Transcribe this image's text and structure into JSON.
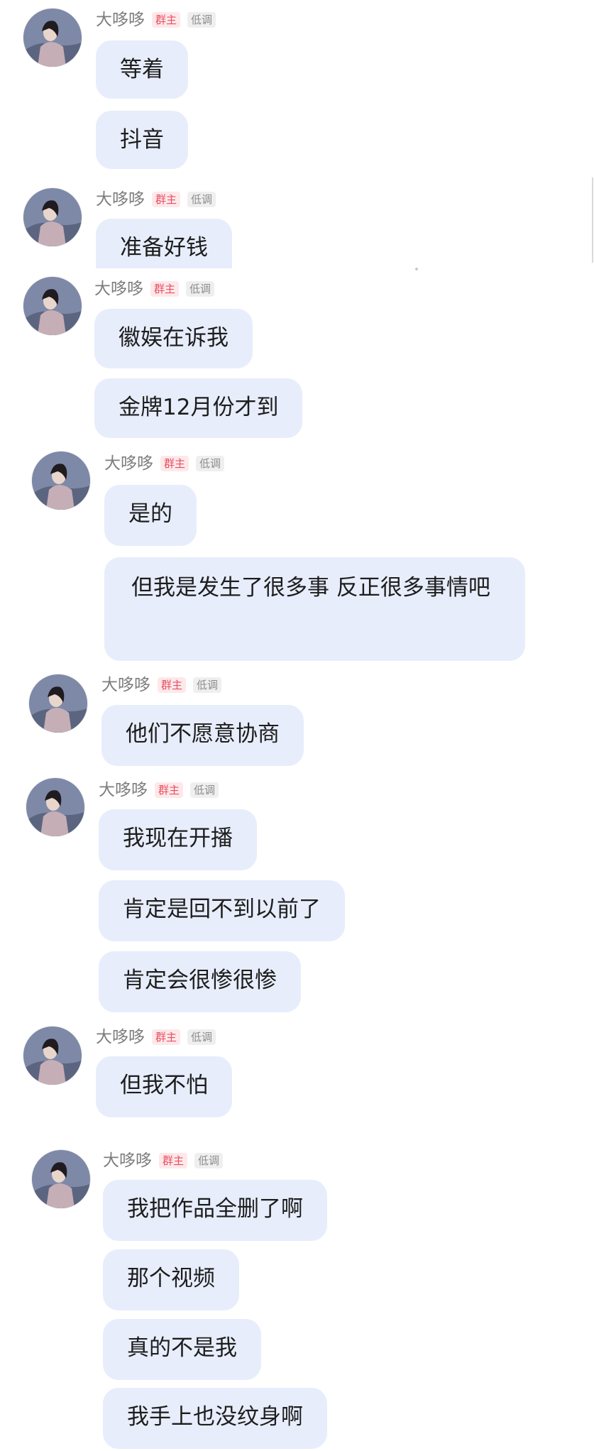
{
  "sender": {
    "name": "大哆哆",
    "badge_owner": "群主",
    "badge_low": "低调",
    "avatar_icon": "profile-photo-icon"
  },
  "colors": {
    "bubble_bg": "#e7edfb",
    "owner_badge": "#e84f61",
    "name_text": "#7d7d7d"
  },
  "groups": [
    {
      "messages": [
        "等着",
        "抖音"
      ]
    },
    {
      "messages": [
        "准备好钱"
      ]
    },
    {
      "messages": [
        "徽娱在诉我",
        "金牌12月份才到"
      ]
    },
    {
      "messages": [
        "是的",
        "但我是发生了很多事 反正很多事情吧"
      ]
    },
    {
      "messages": [
        "他们不愿意协商"
      ]
    },
    {
      "messages": [
        "我现在开播",
        "肯定是回不到以前了",
        "肯定会很惨很惨"
      ]
    },
    {
      "messages": [
        "但我不怕"
      ]
    },
    {
      "messages": [
        "我把作品全删了啊",
        "那个视频",
        "真的不是我",
        "我手上也没纹身啊"
      ]
    }
  ]
}
